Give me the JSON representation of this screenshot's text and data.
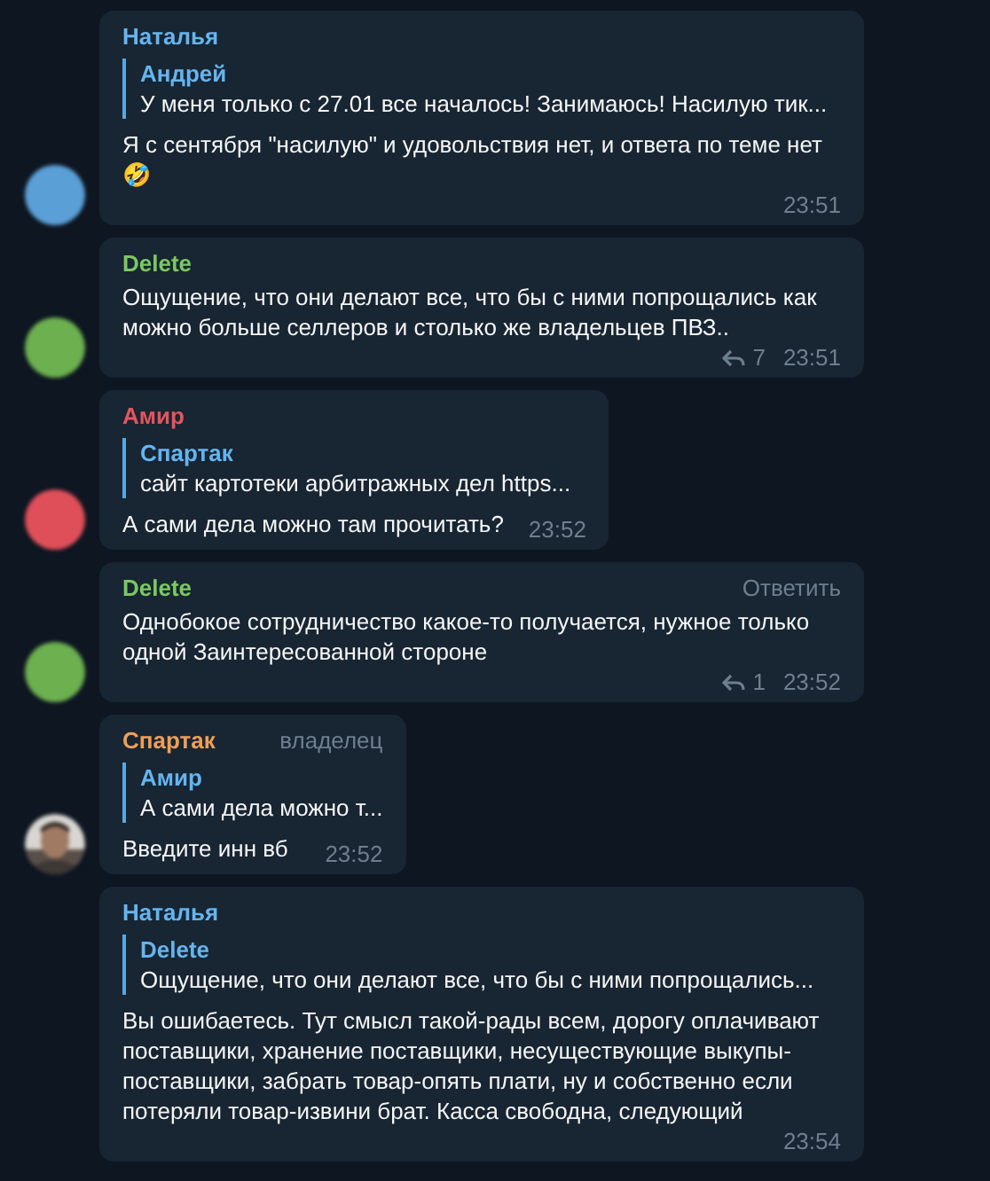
{
  "messages": [
    {
      "sender": "Наталья",
      "color": "#64b5ef",
      "avatar": {
        "kind": "initial",
        "color": "#5a9fd6"
      },
      "reply": {
        "name": "Андрей",
        "text": "У меня только с 27.01 все началось! Занимаюсь! Насилую тик..."
      },
      "text": "Я с сентября \"насилую\" и удовольствия нет, и ответа по теме нет 🤣",
      "time": "23:51"
    },
    {
      "sender": "Delete",
      "color": "#7bc862",
      "avatar": {
        "kind": "initial",
        "color": "#6cb04f"
      },
      "text": "Ощущение, что они делают все, что бы с ними попрощались как можно больше селлеров и столько же владельцев ПВЗ..",
      "replies": "7",
      "time": "23:51"
    },
    {
      "sender": "Амир",
      "color": "#e5555d",
      "avatar": {
        "kind": "initial",
        "color": "#df4f5a"
      },
      "reply": {
        "name": "Спартак",
        "text": "сайт картотеки арбитражных дел https..."
      },
      "text": "А сами дела можно там прочитать?",
      "time": "23:52"
    },
    {
      "sender": "Delete",
      "color": "#7bc862",
      "badge": "Ответить",
      "avatar": {
        "kind": "initial",
        "color": "#6cb04f"
      },
      "text": "Однобокое сотрудничество какое-то получается, нужное только одной Заинтересованной стороне",
      "replies": "1",
      "time": "23:52"
    },
    {
      "sender": "Спартак",
      "color": "#ee9f56",
      "badge": "владелец",
      "reply": {
        "name": "Амир",
        "text": "А сами дела можно т..."
      },
      "text": "Введите инн вб",
      "time": "23:52"
    },
    {
      "sender": "Наталья",
      "color": "#64b5ef",
      "reply": {
        "name": "Delete",
        "text": "Ощущение, что они делают все, что бы с ними попрощались..."
      },
      "text": "Вы ошибаетесь. Тут смысл такой-рады всем, дорогу оплачивают поставщики, хранение поставщики, несуществующие выкупы-поставщики, забрать товар-опять плати, ну и собственно если потеряли товар-извини брат. Касса свободна, следующий",
      "time": "23:54"
    }
  ]
}
